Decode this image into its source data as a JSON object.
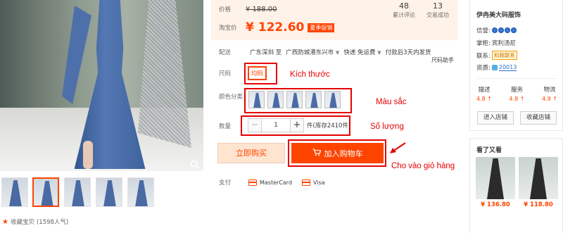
{
  "gallery": {
    "thumb_count": 5,
    "active_thumb": 2,
    "favorite_label": "收藏宝贝",
    "popularity": "(1598人气)"
  },
  "price_box": {
    "orig_label": "价格",
    "orig_price": "¥ 188.00",
    "taobao_label": "淘宝价",
    "current_price": "¥ 122.60",
    "promo_badge": "夏季促销",
    "reviews_count": "48",
    "reviews_label": "累计评论",
    "trades_count": "13",
    "trades_label": "交易成功"
  },
  "shipping": {
    "label": "配送",
    "from": "广东深圳 至",
    "to": "广西防城港东兴市",
    "method": "快递 免运费",
    "delivery": "付款后3天内发货",
    "size_helper": "尺码助手"
  },
  "size": {
    "label": "尺码",
    "option": "均码"
  },
  "color": {
    "label": "颜色分类",
    "swatch_count": 5
  },
  "quantity": {
    "label": "数量",
    "minus": "−",
    "value": "1",
    "plus": "+",
    "stock": "件(库存2410件)"
  },
  "actions": {
    "buy_now": "立即购买",
    "add_to_cart": "加入购物车",
    "cart_icon": "cart-icon"
  },
  "payment": {
    "label": "支付",
    "methods": [
      "MasterCard",
      "Visa"
    ]
  },
  "annotations": {
    "size_note": "Kích thước",
    "color_note": "Màu sắc",
    "qty_note": "Số lượng",
    "cart_note": "Cho vào giỏ hàng",
    "color": "#e60000"
  },
  "shop": {
    "name": "伊冉美大码服饰",
    "reputation_label": "信誉:",
    "keeper_label": "掌柜:",
    "keeper": "宾利汤尼",
    "contact_label": "联系:",
    "contact_badge": "和我联系",
    "qualification_label": "资质:",
    "tmall_id": "20013",
    "scores": [
      {
        "label": "描述",
        "value": "4.8"
      },
      {
        "label": "服务",
        "value": "4.8"
      },
      {
        "label": "物流",
        "value": "4.9"
      }
    ],
    "enter_shop": "进入店铺",
    "fav_shop": "收藏店铺"
  },
  "also_viewed": {
    "title": "看了又看",
    "items": [
      {
        "price": "¥ 136.80"
      },
      {
        "price": "¥ 118.80"
      }
    ]
  },
  "colors": {
    "accent": "#ff4400",
    "price_bg": "#fff2e8",
    "buy_now_bg": "#ffe4d0"
  }
}
